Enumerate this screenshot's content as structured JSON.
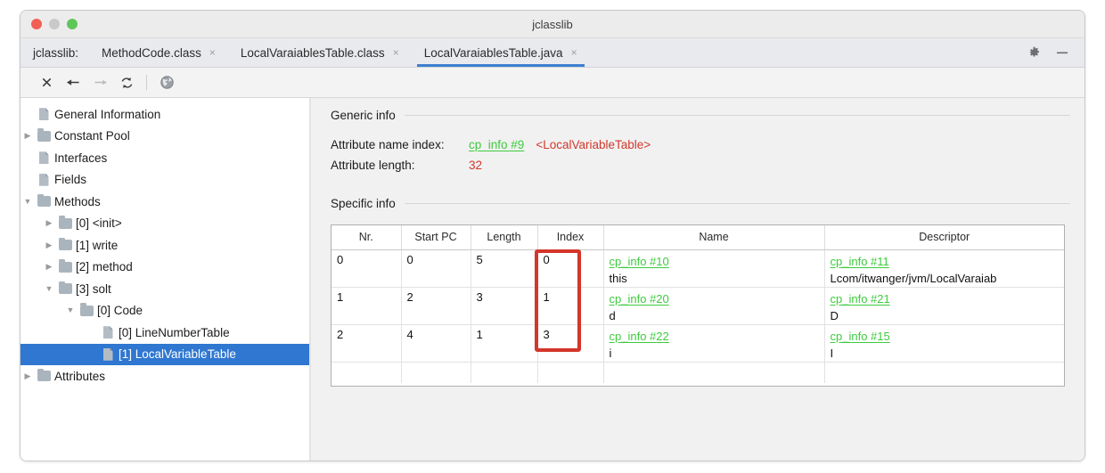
{
  "window": {
    "title": "jclasslib",
    "traffic_lights": [
      "close-red",
      "minimize-amber",
      "zoom-green"
    ]
  },
  "tabbar": {
    "prefix_label": "jclasslib:",
    "tabs": [
      {
        "label": "MethodCode.class",
        "close": "×",
        "active": false
      },
      {
        "label": "LocalVaraiablesTable.class",
        "close": "×",
        "active": false
      },
      {
        "label": "LocalVaraiablesTable.java",
        "close": "×",
        "active": true
      }
    ],
    "window_controls": [
      "gear-icon",
      "minimize-icon"
    ],
    "accent_color": "#3d7fd0"
  },
  "toolbar": {
    "buttons": [
      {
        "name": "close-icon",
        "glyph": "×",
        "enabled": true
      },
      {
        "name": "back-arrow-icon",
        "glyph": "←",
        "enabled": true
      },
      {
        "name": "forward-arrow-icon",
        "glyph": "→",
        "enabled": false
      },
      {
        "name": "reload-icon",
        "glyph": "↻",
        "enabled": true
      },
      {
        "name": "globe-icon",
        "glyph": "●",
        "enabled": true
      }
    ]
  },
  "sidebar": {
    "items": [
      {
        "label": "General Information",
        "icon": "file-icon",
        "indent": 1,
        "twist": "",
        "selected": false
      },
      {
        "label": "Constant Pool",
        "icon": "folder-icon",
        "indent": 0,
        "twist": "▶",
        "selected": false
      },
      {
        "label": "Interfaces",
        "icon": "file-icon",
        "indent": 1,
        "twist": "",
        "selected": false
      },
      {
        "label": "Fields",
        "icon": "file-icon",
        "indent": 1,
        "twist": "",
        "selected": false
      },
      {
        "label": "Methods",
        "icon": "folder-icon",
        "indent": 0,
        "twist": "▼",
        "selected": false
      },
      {
        "label": "[0] <init>",
        "icon": "folder-icon",
        "indent": 1,
        "twist": "▶",
        "selected": false
      },
      {
        "label": "[1] write",
        "icon": "folder-icon",
        "indent": 1,
        "twist": "▶",
        "selected": false
      },
      {
        "label": "[2] method",
        "icon": "folder-icon",
        "indent": 1,
        "twist": "▶",
        "selected": false
      },
      {
        "label": "[3] solt",
        "icon": "folder-icon",
        "indent": 1,
        "twist": "▼",
        "selected": false
      },
      {
        "label": "[0] Code",
        "icon": "folder-icon",
        "indent": 2,
        "twist": "▼",
        "selected": false
      },
      {
        "label": "[0] LineNumberTable",
        "icon": "file-icon",
        "indent": 3,
        "twist": "",
        "selected": false
      },
      {
        "label": "[1] LocalVariableTable",
        "icon": "file-icon",
        "indent": 3,
        "twist": "",
        "selected": true
      },
      {
        "label": "Attributes",
        "icon": "folder-icon",
        "indent": 0,
        "twist": "▶",
        "selected": false
      }
    ],
    "selection_color": "#2f77d1"
  },
  "content": {
    "generic_info": {
      "heading": "Generic info",
      "rows": [
        {
          "key": "Attribute name index:",
          "link": "cp_info #9",
          "note": "<LocalVariableTable>",
          "value": ""
        },
        {
          "key": "Attribute length:",
          "link": "",
          "note": "",
          "value": "32"
        }
      ]
    },
    "specific_info": {
      "heading": "Specific info",
      "table": {
        "columns": [
          "Nr.",
          "Start PC",
          "Length",
          "Index",
          "Name",
          "Descriptor"
        ],
        "rows": [
          {
            "nr": "0",
            "start_pc": "0",
            "length": "5",
            "index": "0",
            "name_link": "cp_info #10",
            "name_value": "this",
            "desc_link": "cp_info #11",
            "desc_value": "Lcom/itwanger/jvm/LocalVaraiab"
          },
          {
            "nr": "1",
            "start_pc": "2",
            "length": "3",
            "index": "1",
            "name_link": "cp_info #20",
            "name_value": "d",
            "desc_link": "cp_info #21",
            "desc_value": "D"
          },
          {
            "nr": "2",
            "start_pc": "4",
            "length": "1",
            "index": "3",
            "name_link": "cp_info #22",
            "name_value": "i",
            "desc_link": "cp_info #15",
            "desc_value": "I"
          }
        ]
      }
    },
    "annotation": {
      "shape": "rectangle",
      "target_column": "Index",
      "color": "#d3362a"
    },
    "link_color": "#3ecb3e",
    "value_color": "#d2382c"
  }
}
